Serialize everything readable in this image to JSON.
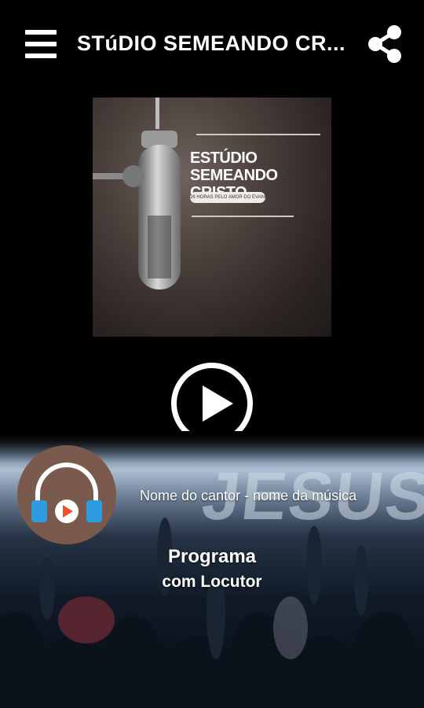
{
  "header": {
    "title": "STúDIO SEMEANDO CR...",
    "menu_icon": "hamburger-menu-icon",
    "share_icon": "share-icon"
  },
  "cover": {
    "title_line1": "ESTÚDIO SEMEANDO",
    "title_line2": "CRISTO",
    "tagline": "26 HORAS PELO AMOR DO EVANGELHO"
  },
  "player": {
    "play_icon": "play-icon"
  },
  "background": {
    "word": "JESUS"
  },
  "now_playing": {
    "song": "Nome do cantor - nome da música",
    "avatar_icon": "headphones-play-icon"
  },
  "program": {
    "title": "Programa",
    "subtitle": "com Locutor"
  },
  "colors": {
    "background": "#000000",
    "avatar_bg": "#7a5a4c",
    "headphone_blue": "#2f9be0",
    "play_orange": "#e8552b"
  }
}
